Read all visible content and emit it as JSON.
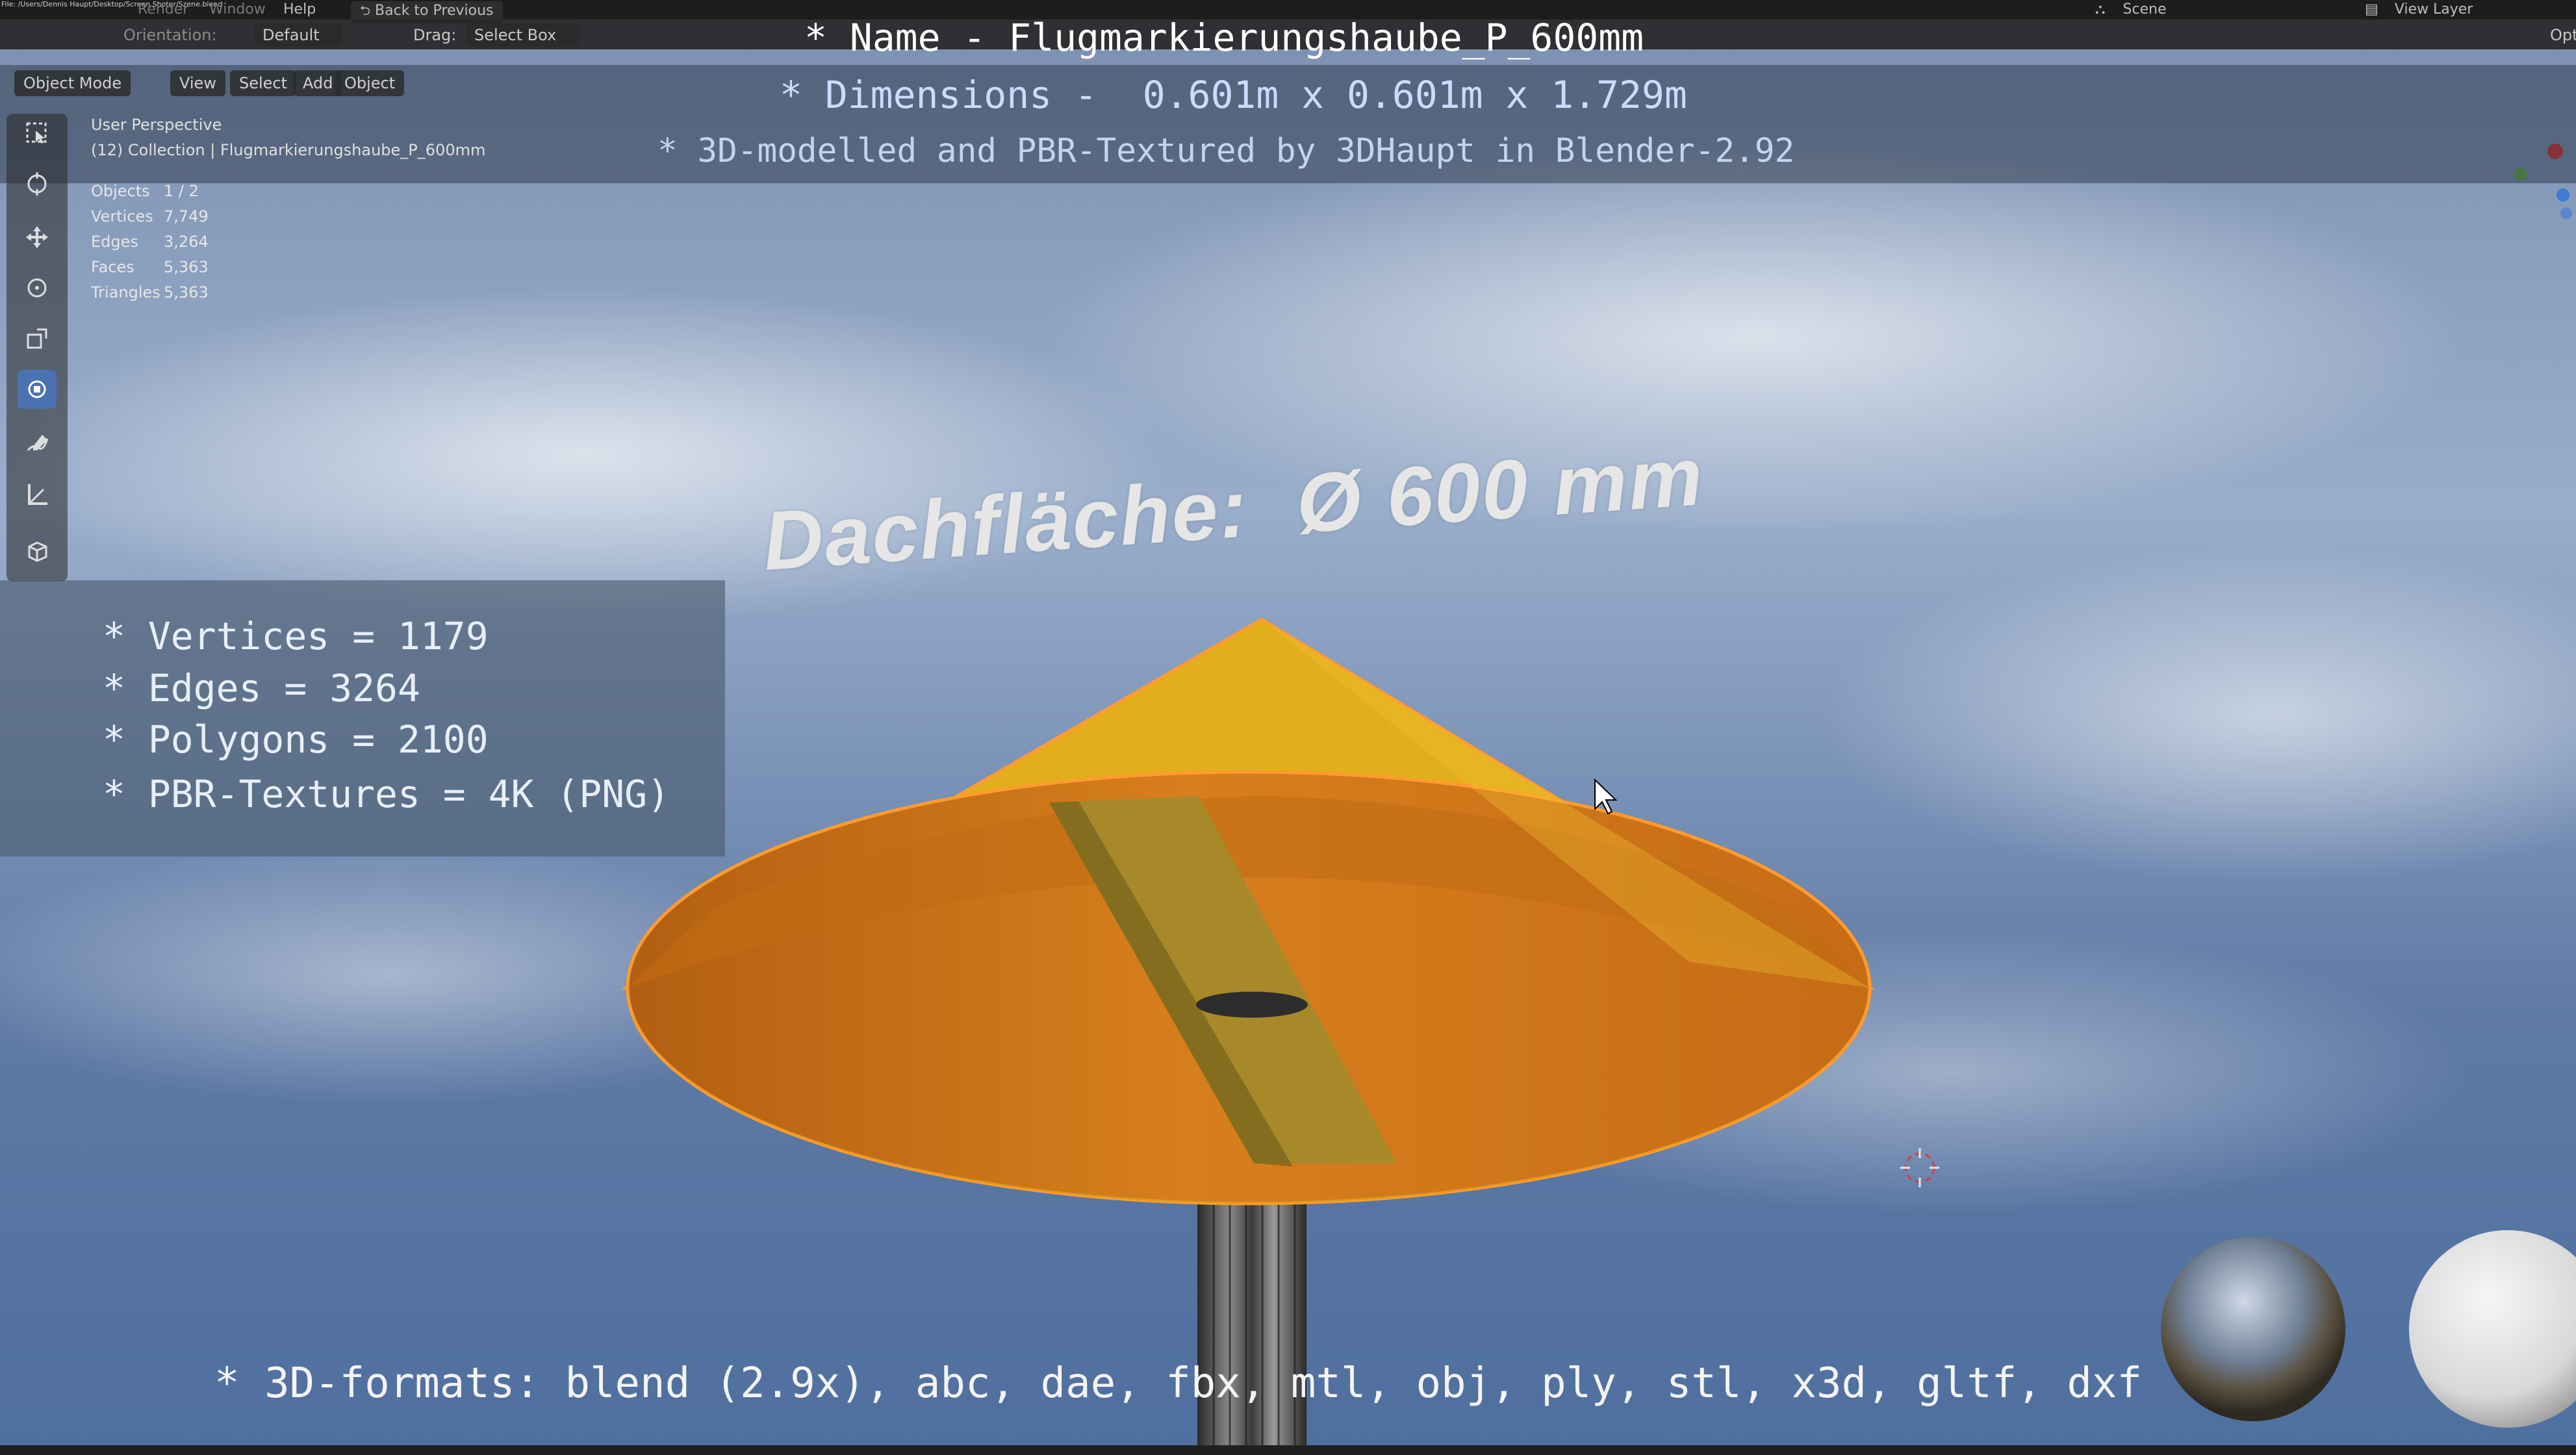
{
  "topbar": {
    "path_line": "File: /Users/Dennis Haupt/Desktop/Screen Shoter/Szene.blend",
    "menu_render": "Render",
    "menu_window": "Window",
    "menu_help": "Help",
    "back_button": "Back to Previous",
    "scene_label": "Scene",
    "view_layer_label": "View Layer"
  },
  "header": {
    "orientation_label": "Orientation:",
    "orientation_value": "Default",
    "drag_label": "Drag:",
    "drag_value": "Select Box",
    "options": "Opti"
  },
  "viewport_menu": {
    "mode": "Object Mode",
    "view": "View",
    "select": "Select",
    "add": "Add",
    "object": "Object"
  },
  "viewport_info": {
    "perspective": "User Perspective",
    "collection": "(12) Collection | Flugmarkierungshaube_P_600mm"
  },
  "stats": [
    {
      "label": "Objects",
      "value": "1 / 2"
    },
    {
      "label": "Vertices",
      "value": "7,749"
    },
    {
      "label": "Edges",
      "value": "3,264"
    },
    {
      "label": "Faces",
      "value": "5,363"
    },
    {
      "label": "Triangles",
      "value": "5,363"
    }
  ],
  "overlay_title": {
    "name_line": "* Name - Flugmarkierungshaube_P_600mm",
    "dimensions_line": "* Dimensions -  0.601m x 0.601m x 1.729m",
    "credit_line": "* 3D-modelled and PBR-Textured by 3DHaupt in Blender-2.92"
  },
  "model_label": "Dachfläche:  Ø 600 mm",
  "mesh_panel": [
    "* Vertices = 1179",
    "* Edges = 3264",
    "* Polygons = 2100",
    "* PBR-Textures = 4K (PNG)"
  ],
  "formats_line": "* 3D-formats: blend (2.9x), abc, dae, fbx, mtl, obj, ply, stl, x3d, gltf, dxf",
  "colors": {
    "cone_yellow": "#e5b21c",
    "cone_inner": "#cf7a1a",
    "selection_outline": "#ff9b2f",
    "active_tool": "#4a72b0",
    "sky": "#7189ad"
  }
}
